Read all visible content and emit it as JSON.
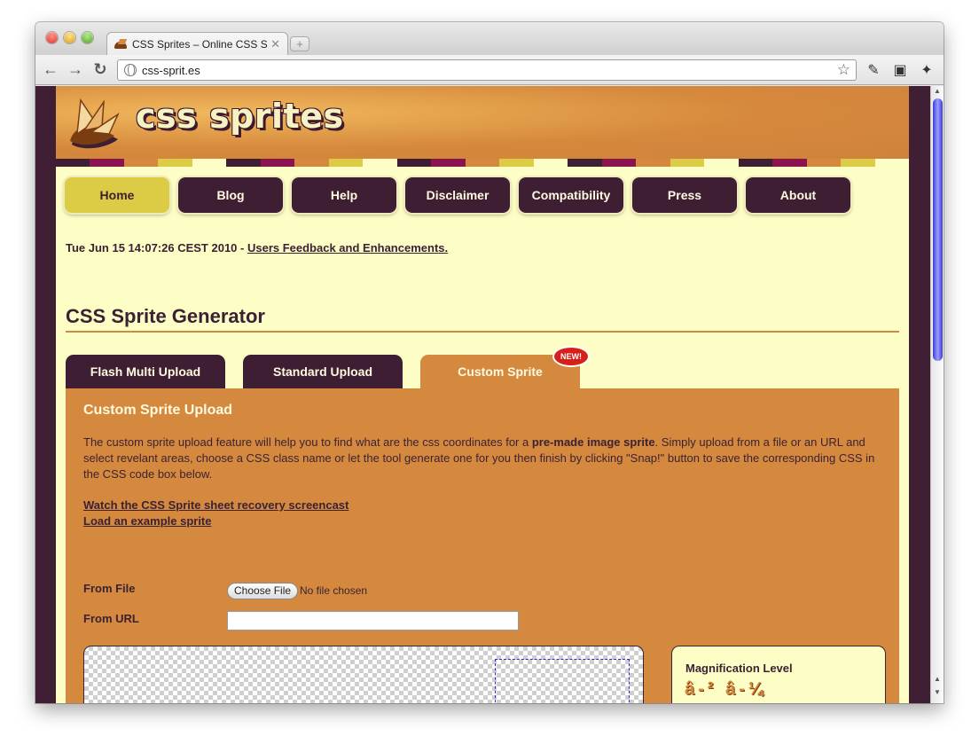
{
  "browser": {
    "tab_title": "CSS Sprites – Online CSS Spr",
    "tab_close": "✕",
    "new_tab": "+",
    "url": "css-sprit.es",
    "back": "←",
    "forward": "→",
    "reload": "↻",
    "bookmark_star": "☆"
  },
  "site": {
    "logo_text": "css sprites",
    "nav": [
      "Home",
      "Blog",
      "Help",
      "Disclaimer",
      "Compatibility",
      "Press",
      "About"
    ],
    "active_nav": "Home",
    "stripe_colors": [
      "#3e1e33",
      "#8b1450",
      "#d5893e",
      "#dccb44",
      "#fdfdc6"
    ]
  },
  "dateline": {
    "date": "Tue Jun 15 14:07:26 CEST 2010 - ",
    "link": "Users Feedback and Enhancements."
  },
  "main": {
    "title": "CSS Sprite Generator",
    "tabs": [
      "Flash Multi Upload",
      "Standard Upload",
      "Custom Sprite"
    ],
    "active_tab": "Custom Sprite",
    "new_badge": "NEW!",
    "panel_title": "Custom Sprite Upload",
    "desc_1": "The custom sprite upload feature will help you to find what are the css coordinates for a ",
    "desc_bold": "pre-made image sprite",
    "desc_2": ". Simply upload from a file or an URL and select revelant areas, choose a CSS class name or let the tool generate one for you then finish by clicking \"Snap!\" button to save the corresponding CSS in the CSS code box below.",
    "link_screencast": "Watch the CSS Sprite sheet recovery screencast",
    "link_example": "Load an example sprite",
    "from_file_label": "From File",
    "choose_file": "Choose File",
    "no_file": "No file chosen",
    "from_url_label": "From URL",
    "url_value": "",
    "magnification_title": "Magnification Level",
    "magnification_icons": "â-² â-¼"
  }
}
